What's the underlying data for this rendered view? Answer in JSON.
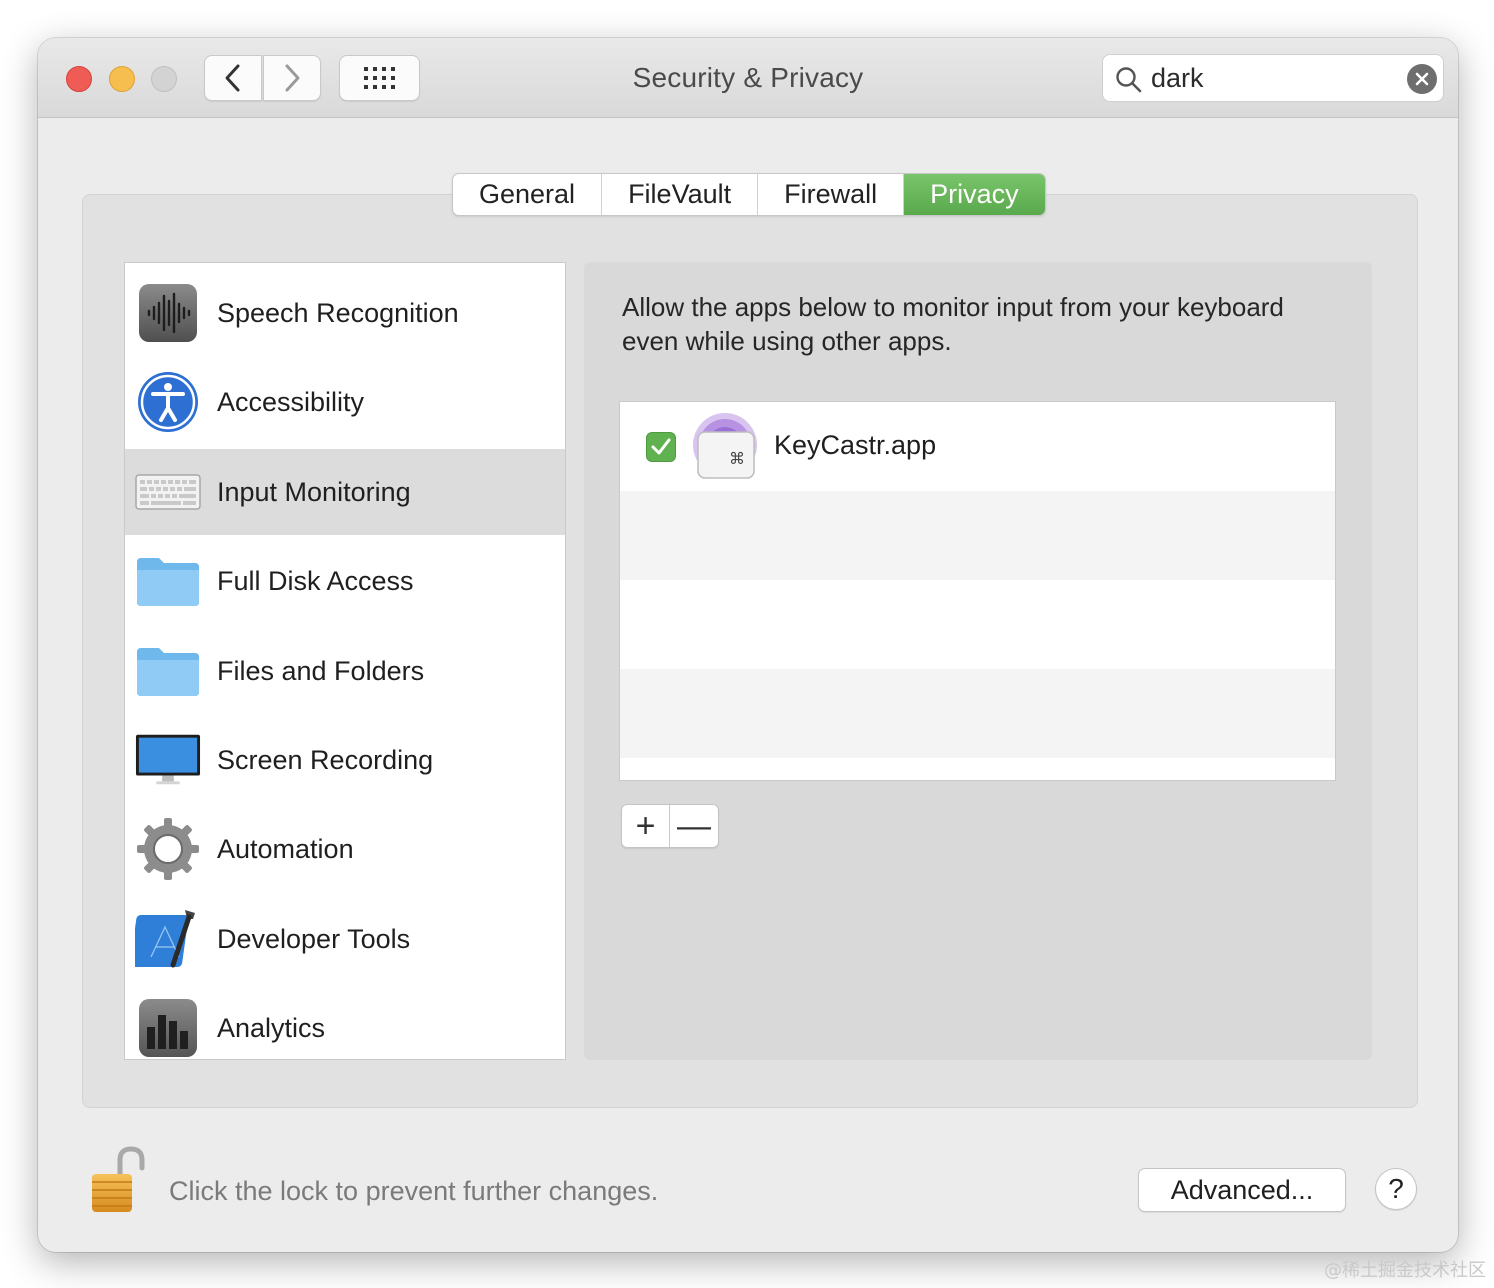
{
  "window": {
    "title": "Security & Privacy"
  },
  "toolbar": {
    "back_icon": "chevron-left-icon",
    "forward_icon": "chevron-right-icon",
    "grid_icon": "grid-icon"
  },
  "search": {
    "value": "dark",
    "placeholder": "Search"
  },
  "tabs": [
    {
      "label": "General",
      "active": false
    },
    {
      "label": "FileVault",
      "active": false
    },
    {
      "label": "Firewall",
      "active": false
    },
    {
      "label": "Privacy",
      "active": true
    }
  ],
  "sidebar": {
    "items": [
      {
        "label": "Speech Recognition",
        "icon": "waveform-icon",
        "selected": false
      },
      {
        "label": "Accessibility",
        "icon": "accessibility-icon",
        "selected": false
      },
      {
        "label": "Input Monitoring",
        "icon": "keyboard-icon",
        "selected": true
      },
      {
        "label": "Full Disk Access",
        "icon": "folder-icon",
        "selected": false
      },
      {
        "label": "Files and Folders",
        "icon": "folder-icon",
        "selected": false
      },
      {
        "label": "Screen Recording",
        "icon": "monitor-icon",
        "selected": false
      },
      {
        "label": "Automation",
        "icon": "gear-icon",
        "selected": false
      },
      {
        "label": "Developer Tools",
        "icon": "developer-tools-icon",
        "selected": false
      },
      {
        "label": "Analytics",
        "icon": "bar-chart-icon",
        "selected": false
      }
    ]
  },
  "panel": {
    "description": "Allow the apps below to monitor input from your keyboard even while using other apps.",
    "apps": [
      {
        "name": "KeyCastr.app",
        "checked": true
      }
    ],
    "add_label": "+",
    "remove_label": "—"
  },
  "footer": {
    "lock_text": "Click the lock to prevent further changes.",
    "advanced_label": "Advanced...",
    "help_label": "?"
  },
  "watermark": "@稀土掘金技术社区",
  "colors": {
    "accent_green": "#5fb24f",
    "close": "#ee5c55",
    "minimize": "#f6be4f",
    "zoom": "#d3d3d3"
  }
}
